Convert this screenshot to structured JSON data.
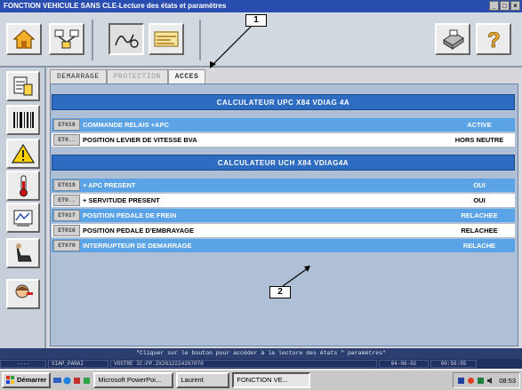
{
  "window": {
    "title": "FONCTION VEHICULE SANS CLE-Lecture des états et paramètres",
    "btn_min": "_",
    "btn_max": "□",
    "btn_close": "×"
  },
  "tabs": [
    {
      "label": "DEMARRAGE"
    },
    {
      "label": "PROTECTION"
    },
    {
      "label": "ACCES"
    }
  ],
  "callouts": {
    "one": "1",
    "two": "2"
  },
  "section1": {
    "title": "CALCULATEUR UPC X84 VDIAG 4A",
    "rows": [
      {
        "code": "ET019",
        "label": "COMMANDE RELAIS +APC",
        "value": "ACTIVE"
      },
      {
        "code": "ET0..",
        "label": "POSITION LEVIER DE VITESSE BVA",
        "value": "HORS NEUTRE"
      }
    ]
  },
  "section2": {
    "title": "CALCULATEUR UCH X84 VDIAG4A",
    "rows": [
      {
        "code": "ET019",
        "label": "+ APC PRESENT",
        "value": "OUI"
      },
      {
        "code": "ET0..",
        "label": "+ SERVITUDE PRESENT",
        "value": "OUI"
      },
      {
        "code": "ET017",
        "label": "POSITION PEDALE DE FREIN",
        "value": "RELACHEE"
      },
      {
        "code": "ET016",
        "label": "POSITION PEDALE D'EMBRAYAGE",
        "value": "RELACHEE"
      },
      {
        "code": "ET070",
        "label": "INTERRUPTEUR DE DEMARRAGE",
        "value": "RELACHE"
      }
    ]
  },
  "status": {
    "hint": "\"Cliquer sur le bouton pour accéder à la lecture des états \" paramètres\"",
    "cell1": "----",
    "cell2": "SIAP_PARAI",
    "cell3": "VOSTRE IC:PP.2X2612224267070",
    "date": "04-06-02",
    "time": "00:56:05"
  },
  "taskbar": {
    "start": "Démarrer",
    "task1": "Microsoft PowerPoi...",
    "task2": "Laurent",
    "task3": "FONCTION VE...",
    "clock": "08:53"
  },
  "colors": {
    "header_blue": "#2d6cc0",
    "row_blue": "#5aa3e6",
    "title_bar": "#2a4db0"
  }
}
